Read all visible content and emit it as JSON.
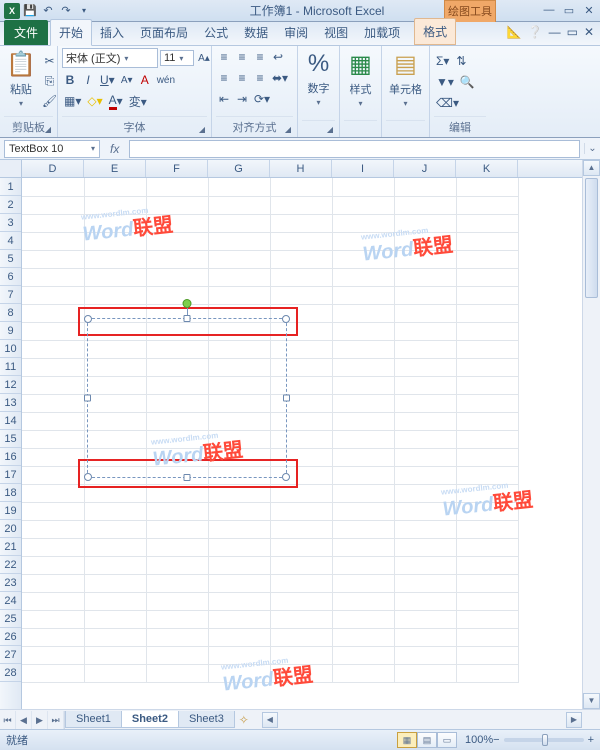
{
  "title": {
    "doc": "工作簿1",
    "app": "Microsoft Excel",
    "sep": " - "
  },
  "context_tab": "绘图工具",
  "tabs": {
    "file": "文件",
    "home": "开始",
    "insert": "插入",
    "layout": "页面布局",
    "formulas": "公式",
    "data": "数据",
    "review": "审阅",
    "view": "视图",
    "addins": "加载项",
    "format": "格式"
  },
  "ribbon": {
    "clipboard": {
      "paste": "粘贴",
      "label": "剪贴板"
    },
    "font": {
      "family": "宋体 (正文)",
      "size": "11",
      "label": "字体"
    },
    "align": {
      "label": "对齐方式"
    },
    "number": {
      "btn": "数字",
      "label": ""
    },
    "styles": {
      "btn": "样式",
      "label": ""
    },
    "cells": {
      "btn": "单元格",
      "label": ""
    },
    "editing": {
      "label": "编辑"
    }
  },
  "name_box": "TextBox 10",
  "fx_label": "fx",
  "columns": [
    "D",
    "E",
    "F",
    "G",
    "H",
    "I",
    "J",
    "K"
  ],
  "rows_start": 1,
  "rows_end": 28,
  "sheets": {
    "s1": "Sheet1",
    "s2": "Sheet2",
    "s3": "Sheet3"
  },
  "status": {
    "ready": "就绪",
    "zoom": "100%"
  },
  "watermark": {
    "text": "Word",
    "suffix": "联盟",
    "sub": "www.wordlm.com"
  }
}
